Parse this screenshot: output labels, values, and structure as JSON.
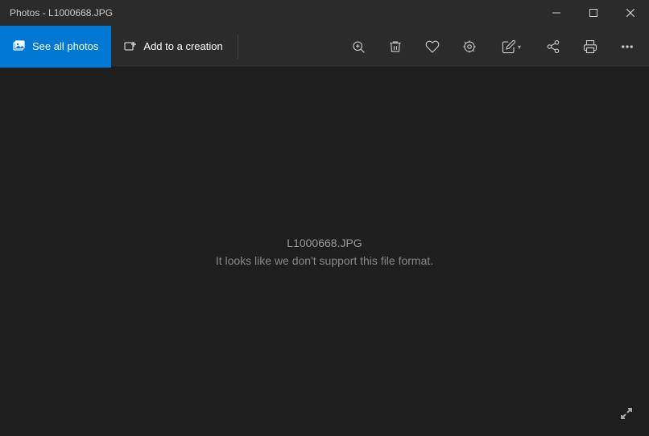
{
  "titlebar": {
    "title": "Photos - L1000668.JPG",
    "minimize_label": "Minimize",
    "maximize_label": "Maximize",
    "close_label": "Close"
  },
  "toolbar": {
    "see_all_photos_label": "See all photos",
    "add_to_creation_label": "Add to a creation",
    "zoom_icon": "zoom-icon",
    "delete_icon": "delete-icon",
    "heart_icon": "heart-icon",
    "enhance_icon": "enhance-icon",
    "edit_icon": "edit-icon",
    "share_icon": "share-icon",
    "print_icon": "print-icon",
    "more_icon": "more-icon"
  },
  "main": {
    "filename": "L1000668.JPG",
    "error_message": "It looks like we don't support this file format."
  },
  "expand": {
    "label": "Expand"
  }
}
